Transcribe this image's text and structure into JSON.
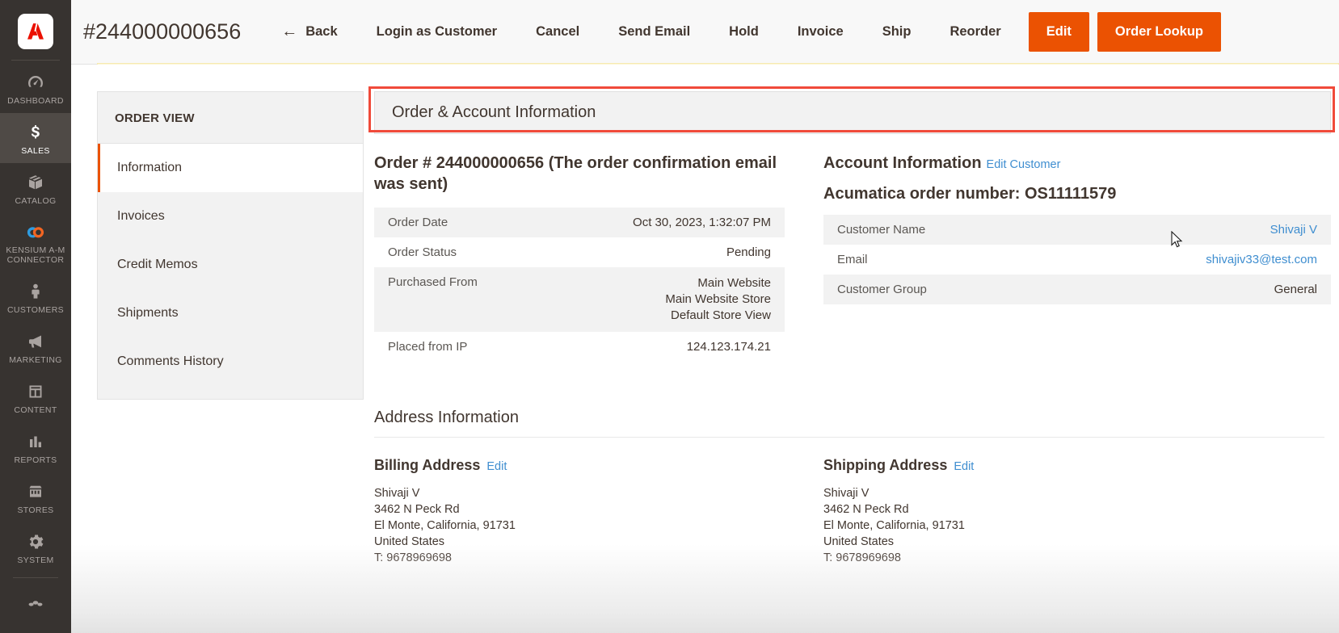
{
  "header": {
    "order_title": "#244000000656",
    "actions": [
      {
        "label": "Back",
        "icon": "arrow-left-icon",
        "style": "link"
      },
      {
        "label": "Login as Customer",
        "style": "link"
      },
      {
        "label": "Cancel",
        "style": "link"
      },
      {
        "label": "Send Email",
        "style": "link"
      },
      {
        "label": "Hold",
        "style": "link"
      },
      {
        "label": "Invoice",
        "style": "link"
      },
      {
        "label": "Ship",
        "style": "link"
      },
      {
        "label": "Reorder",
        "style": "link"
      },
      {
        "label": "Edit",
        "style": "primary"
      },
      {
        "label": "Order Lookup",
        "style": "primary"
      }
    ],
    "primary_color": "#eb5202"
  },
  "sidebar": {
    "logo": "adobe-commerce-logo",
    "items": [
      {
        "label": "Dashboard",
        "icon": "dashboard-gauge-icon",
        "active": false
      },
      {
        "label": "Sales",
        "icon": "dollar-sign-icon",
        "active": true
      },
      {
        "label": "Catalog",
        "icon": "box-icon",
        "active": false
      },
      {
        "label": "Kensium A-M\nConnector",
        "icon": "kensium-link-icon",
        "active": false
      },
      {
        "label": "Customers",
        "icon": "person-icon",
        "active": false
      },
      {
        "label": "Marketing",
        "icon": "megaphone-icon",
        "active": false
      },
      {
        "label": "Content",
        "icon": "layout-page-icon",
        "active": false
      },
      {
        "label": "Reports",
        "icon": "bar-chart-icon",
        "active": false
      },
      {
        "label": "Stores",
        "icon": "storefront-icon",
        "active": false
      },
      {
        "label": "System",
        "icon": "gear-icon",
        "active": false
      }
    ]
  },
  "order_view_panel": {
    "title": "ORDER VIEW",
    "items": [
      {
        "label": "Information",
        "active": true
      },
      {
        "label": "Invoices",
        "active": false
      },
      {
        "label": "Credit Memos",
        "active": false
      },
      {
        "label": "Shipments",
        "active": false
      },
      {
        "label": "Comments History",
        "active": false
      }
    ]
  },
  "main": {
    "section_title": "Order & Account Information",
    "highlight_color": "#f04a3a",
    "order_block": {
      "heading": "Order # 244000000656 (The order confirmation email was sent)",
      "rows": [
        {
          "key": "Order Date",
          "value": "Oct 30, 2023, 1:32:07 PM",
          "alt": true
        },
        {
          "key": "Order Status",
          "value": "Pending",
          "alt": false
        },
        {
          "key": "Purchased From",
          "value": "Main Website\nMain Website Store\nDefault Store View",
          "alt": true
        },
        {
          "key": "Placed from IP",
          "value": "124.123.174.21",
          "alt": false
        }
      ]
    },
    "account_block": {
      "heading": "Account Information",
      "edit_link": "Edit Customer",
      "subheading": "Acumatica order number: OS11111579",
      "rows": [
        {
          "key": "Customer Name",
          "value": "Shivaji V",
          "alt": true,
          "link": true
        },
        {
          "key": "Email",
          "value": "shivajiv33@test.com",
          "alt": false,
          "link": true
        },
        {
          "key": "Customer Group",
          "value": "General",
          "alt": true,
          "link": false
        }
      ]
    },
    "address_section": {
      "title": "Address Information",
      "billing": {
        "heading": "Billing Address",
        "edit_link": "Edit",
        "lines": "Shivaji V\n3462 N Peck Rd\nEl Monte, California, 91731\nUnited States\nT: 9678969698"
      },
      "shipping": {
        "heading": "Shipping Address",
        "edit_link": "Edit",
        "lines": "Shivaji V\n3462 N Peck Rd\nEl Monte, California, 91731\nUnited States\nT: 9678969698"
      }
    }
  }
}
